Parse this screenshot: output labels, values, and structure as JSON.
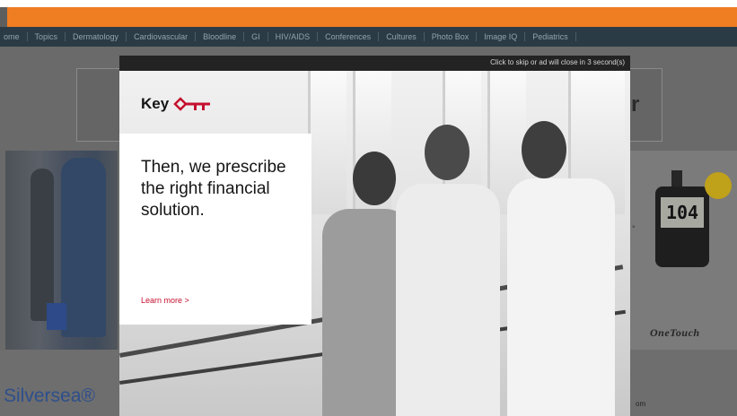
{
  "nav": {
    "items": [
      "ome",
      "Topics",
      "Dermatology",
      "Cardiovascular",
      "Bloodline",
      "GI",
      "HIV/AIDS",
      "Conferences",
      "Cultures",
      "Photo Box",
      "Image IQ",
      "Pediatrics"
    ]
  },
  "background": {
    "right_partial_text": "r",
    "meter_reading": "104",
    "side_mark": "°",
    "meter_badge": "",
    "brand": "OneTouch",
    "bottom_title": "Silversea®",
    "bottom_left_tag": "",
    "bottom_right_text": "om"
  },
  "modal": {
    "skip_text": "Click to skip or ad will close in 3 second(s)",
    "logo_text": "Key",
    "headline": "Then, we prescribe the right financial solution.",
    "cta": "Learn more >",
    "colors": {
      "brand_red": "#c4102e",
      "orange_bar": "#ef7d22",
      "nav_bg": "#2b3b46"
    }
  }
}
